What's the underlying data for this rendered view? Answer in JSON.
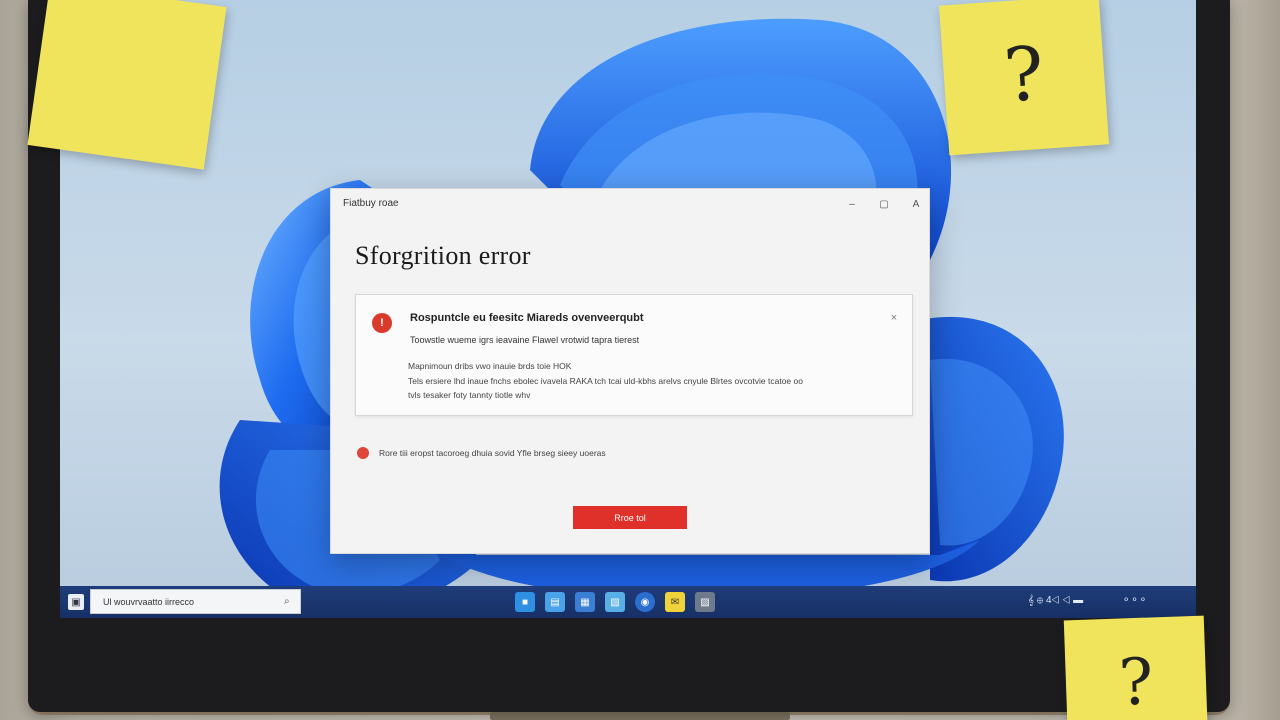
{
  "dialog": {
    "window_title": "Fiatbuy roae",
    "heading": "Sforgrition error",
    "controls": {
      "minimize": "–",
      "maximize": "▢",
      "close": "A"
    },
    "error_card": {
      "title": "Rospuntcle eu feesitc Miareds ovenveerqubt",
      "subtitle": "Toowstle wueme igrs ieavaine Flawel vrotwid tapra tierest",
      "detail_lines": [
        "Mapnimoun dribs vwo inauie brds toie HOK",
        "Tels ersiere lhd inaue fnchs ebolec ivavela RAKA tch tcai uld-kbhs arelvs cnyule Blrtes ovcotvie tcatoe oo",
        "tvls tesaker foty tannty tiotle whv"
      ],
      "close_glyph": "×",
      "icon_glyph": "!"
    },
    "note": "Rore tiii eropst tacoroeg dhuia sovid Yfle brseg sieey uoeras",
    "primary_button": "Rroe tol"
  },
  "taskbar": {
    "search_text": "Ul wouvrvaatto iirrecco",
    "search_icon": "⌕",
    "tray_text": "𝄞   ⊕  4◁  ◁  ▬",
    "tray_clock": "⚬⚬⚬",
    "apps": [
      {
        "name": "file-explorer-icon",
        "color": "#2f8fe0"
      },
      {
        "name": "browser-icon",
        "color": "#4aa2e8"
      },
      {
        "name": "store-icon",
        "color": "#3b7fd4"
      },
      {
        "name": "photos-icon",
        "color": "#58b0e6"
      },
      {
        "name": "edge-icon",
        "color": "#2a6fd0"
      },
      {
        "name": "mail-icon",
        "color": "#f0d23a"
      },
      {
        "name": "gallery-icon",
        "color": "#6c7a8c"
      }
    ]
  },
  "stickies": {
    "top_right": "?",
    "bottom_right": "?"
  }
}
